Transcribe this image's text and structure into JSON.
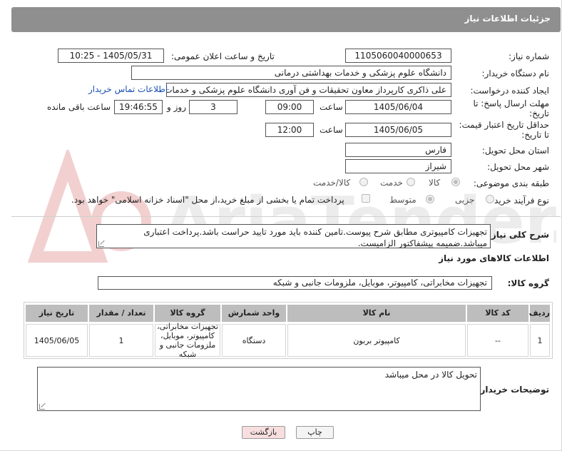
{
  "header": {
    "title": "جزئیات اطلاعات نیاز"
  },
  "fields": {
    "need_number_label": "شماره نیاز:",
    "need_number": "1105060040000653",
    "announce_label": "تاریخ و ساعت اعلان عمومی:",
    "announce_value": "1405/05/31 - 10:25",
    "buyer_org_label": "نام دستگاه خریدار:",
    "buyer_org": "دانشگاه علوم پزشکی و خدمات بهداشتی درمانی",
    "creator_label": "ایجاد کننده درخواست:",
    "creator": "علی  ذاکری کارپرداز معاون تحقیقات و فن آوری دانشگاه علوم پزشکی و خدمات",
    "contact_link": "اطلاعات تماس خریدار",
    "deadline_label_1": "مهلت ارسال پاسخ: تا",
    "deadline_label_2": "تاریخ:",
    "deadline_date": "1405/06/04",
    "time_label": "ساعت",
    "deadline_time": "09:00",
    "days_value": "3",
    "days_label": "روز و",
    "remaining_time": "19:46:55",
    "remaining_label": "ساعت باقی مانده",
    "min_validity_label_1": "حداقل تاریخ اعتبار قیمت:",
    "min_validity_label_2": "تا تاریخ:",
    "validity_date": "1405/06/05",
    "validity_time_label": "ساعت",
    "validity_time": "12:00",
    "province_label": "استان محل تحویل:",
    "province": "فارس",
    "city_label": "شهر محل تحویل:",
    "city": "شیراز",
    "category_label": "طبقه بندی موضوعی:",
    "category_options": [
      "کالا",
      "خدمت",
      "کالا/خدمت"
    ],
    "process_label": "نوع فرآیند خرید :",
    "process_options": [
      "جزیی",
      "متوسط"
    ],
    "payment_note": "پرداخت تمام یا بخشی از مبلغ خرید،از محل \"اسناد خزانه اسلامی\" خواهد بود."
  },
  "description": {
    "label": "شرح کلی نیاز:",
    "text": "تجهیزات کامپیوتری مطابق شرح پیوست.تامین کننده باید مورد تایید حراست باشد.پرداخت اعتباری میباشد.ضمیمه پیشفاکتور الزامیست."
  },
  "goods": {
    "section_title": "اطلاعات کالاهای مورد نیاز",
    "group_label": "گروه کالا:",
    "group_value": "تجهیزات مخابراتی، کامپیوتر، موبایل، ملزومات جانبی و شبکه"
  },
  "table": {
    "headers": [
      "ردیف",
      "کد کالا",
      "نام کالا",
      "واحد شمارش",
      "گروه کالا",
      "تعداد / مقدار",
      "تاریخ نیاز"
    ],
    "rows": [
      [
        "1",
        "--",
        "کامپیوتر بربون",
        "دستگاه",
        "تجهیزات مخابراتی، کامپیوتر، موبایل، ملزومات جانبی و شبکه",
        "1",
        "1405/06/05"
      ]
    ]
  },
  "buyer_notes": {
    "label": "توضیحات خریدار:",
    "text": "تحویل کالا در محل میباشد"
  },
  "buttons": {
    "print": "چاپ",
    "back": "بازگشت"
  },
  "watermark": "AriaTender.net",
  "colors": {
    "header_bg": "#8f8f8f",
    "table_header_bg": "#bdbdbd",
    "link": "#1a4fb5",
    "back_btn_bg": "#f8dede"
  }
}
